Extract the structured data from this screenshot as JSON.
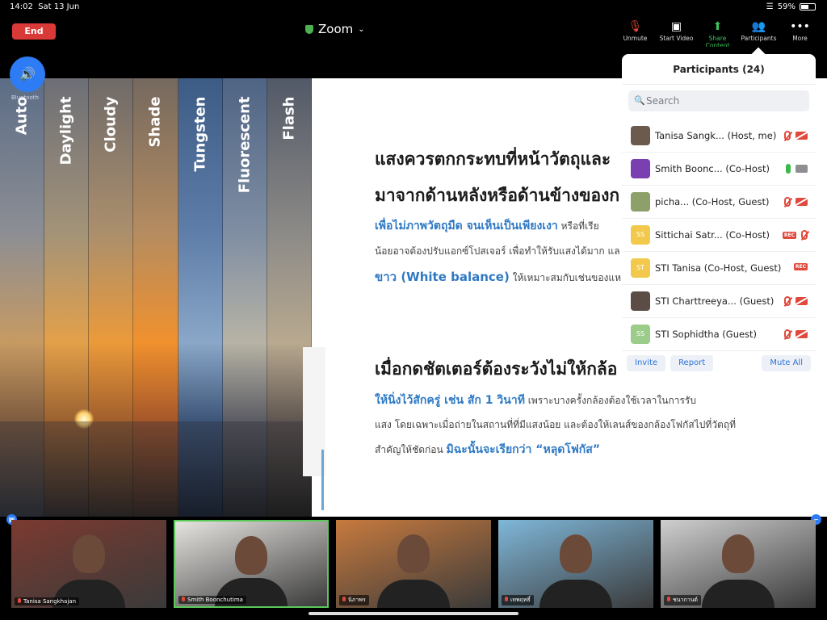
{
  "status_bar": {
    "time": "14:02",
    "date": "Sat 13 Jun",
    "battery": "59%",
    "battery_level": 0.59
  },
  "topbar": {
    "end_label": "End",
    "meeting_title": "Zoom",
    "tools": [
      {
        "label": "Unmute",
        "icon": "mic-off-icon"
      },
      {
        "label": "Start Video",
        "icon": "video-off-icon"
      },
      {
        "label": "Share Content",
        "icon": "share-icon",
        "color": "#3cc25a"
      },
      {
        "label": "Participants",
        "icon": "participants-icon"
      },
      {
        "label": "More",
        "icon": "more-icon"
      }
    ]
  },
  "share": {
    "bluetooth_label": "Bluetooth",
    "white_balance_strips": [
      "Auto",
      "Daylight",
      "Cloudy",
      "Shade",
      "Tungsten",
      "Fluorescent",
      "Flash"
    ],
    "slide": {
      "heading_1_line_1": "แสงควรตกกระทบที่หน้าวัตถุและ",
      "heading_1_line_2": "มาจากด้านหลังหรือด้านข้างของก",
      "para_1_highlight": "เพื่อไม่ภาพวัตถุมืด จนเห็นเป็นเพียงเงา",
      "para_1_rest": "หรือที่เรีย",
      "para_1_line_2": "น้อยอาจต้องปรับแอกซ์โปสเจอร์ เพื่อทำให้รับแสงได้มาก แล",
      "para_1_wb": "ขาว (White balance)",
      "para_1_line_3_rest": "ให้เหมาะสมกับเช่นของแหล่",
      "heading_2": "เมื่อกดชัตเตอร์ต้องระวังไม่ให้กล้อ",
      "para_2_highlight": "ให้นิ่งไว้สักครู่ เช่น สัก 1 วินาที",
      "para_2_rest": "เพราะบางครั้งกล้องต้องใช้เวลาในการรับ",
      "para_2_line_2": "แสง โดยเฉพาะเมื่อถ่ายในสถานที่ที่มีแสงน้อย และต้องให้เลนส์ของกล้องโฟกัสไปที่วัตถุที่",
      "para_2_line_3": "สำคัญให้ชัดก่อน",
      "para_2_highlight_2": "มิฉะนั้นจะเรียกว่า “หลุดโฟกัส”"
    }
  },
  "participants": {
    "title": "Participants (24)",
    "search_placeholder": "Search",
    "rows": [
      {
        "name": "Tanisa Sangk...",
        "role": "(Host, me)",
        "avatar_color": "#6b5b4e",
        "initials": "",
        "mic": "off",
        "cam": "off",
        "rec": false
      },
      {
        "name": "Smith Boonc...",
        "role": "(Co-Host)",
        "avatar_color": "#7a3fb0",
        "initials": "",
        "mic": "on",
        "cam": "on",
        "rec": false
      },
      {
        "name": "picha...",
        "role": "(Co-Host, Guest)",
        "avatar_color": "#8da06a",
        "initials": "",
        "mic": "off",
        "cam": "off",
        "rec": false
      },
      {
        "name": "Sittichai Satr...",
        "role": "(Co-Host)",
        "avatar_color": "#f2c94c",
        "initials": "SS",
        "mic": "off",
        "cam": "none",
        "rec": true
      },
      {
        "name": "STI Tanisa",
        "role": "(Co-Host, Guest)",
        "avatar_color": "#f2c94c",
        "initials": "ST",
        "mic": "none",
        "cam": "none",
        "rec": true
      },
      {
        "name": "STI Charttreeya...",
        "role": "(Guest)",
        "avatar_color": "#5b4d45",
        "initials": "",
        "mic": "off",
        "cam": "off",
        "rec": false
      },
      {
        "name": "STI Sophidtha",
        "role": "(Guest)",
        "avatar_color": "#9ccc8a",
        "initials": "SS",
        "mic": "off",
        "cam": "off",
        "rec": false
      }
    ],
    "invite_label": "Invite",
    "report_label": "Report",
    "mute_all_label": "Mute All"
  },
  "thumbnails": [
    {
      "name": "Tanisa Sangkhajan",
      "bg": "#7b3a30"
    },
    {
      "name": "Smith Boonchutima",
      "bg": "#e6e4e0",
      "active": true
    },
    {
      "name": "นิภาพร",
      "bg": "#c77a3e"
    },
    {
      "name": "เทพฤทธิ์",
      "bg": "#7fb7d9"
    },
    {
      "name": "ชนากานต์",
      "bg": "#cfcfcf"
    }
  ]
}
